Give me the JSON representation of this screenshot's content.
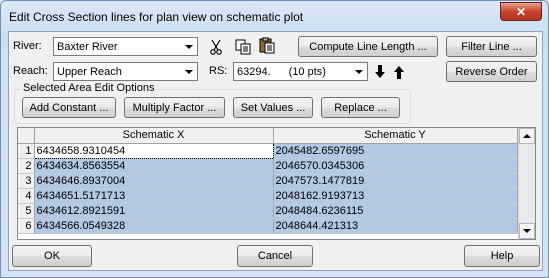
{
  "window": {
    "title": "Edit Cross Section lines for plan view on schematic plot",
    "close_label": "✕"
  },
  "river": {
    "label": "River:",
    "value": "Baxter River"
  },
  "reach": {
    "label": "Reach:",
    "value": "Upper Reach"
  },
  "rs": {
    "label": "RS:",
    "value": "63294.",
    "points": "(10 pts)"
  },
  "buttons": {
    "compute_line_length": "Compute Line Length ...",
    "filter_line": "Filter Line ...",
    "reverse_order": "Reverse Order",
    "add_constant": "Add Constant ...",
    "multiply_factor": "Multiply Factor ...",
    "set_values": "Set Values ...",
    "replace": "Replace ...",
    "ok": "OK",
    "cancel": "Cancel",
    "help": "Help"
  },
  "group": {
    "legend": "Selected Area Edit Options"
  },
  "table": {
    "columns": [
      "Schematic X",
      "Schematic Y"
    ],
    "rows": [
      {
        "n": "1",
        "x": "6434658.9310454",
        "y": "2045482.6597695"
      },
      {
        "n": "2",
        "x": "6434634.8563554",
        "y": "2046570.0345306"
      },
      {
        "n": "3",
        "x": "6434646.8937004",
        "y": "2047573.1477819"
      },
      {
        "n": "4",
        "x": "6434651.5171713",
        "y": "2048162.9193713"
      },
      {
        "n": "5",
        "x": "6434612.8921591",
        "y": "2048484.6236115"
      },
      {
        "n": "6",
        "x": "6434566.0549328",
        "y": "2048644.421313"
      }
    ]
  },
  "icons": [
    "cut-icon",
    "copy-icon",
    "paste-icon",
    "arrow-down-icon",
    "arrow-up-icon"
  ]
}
